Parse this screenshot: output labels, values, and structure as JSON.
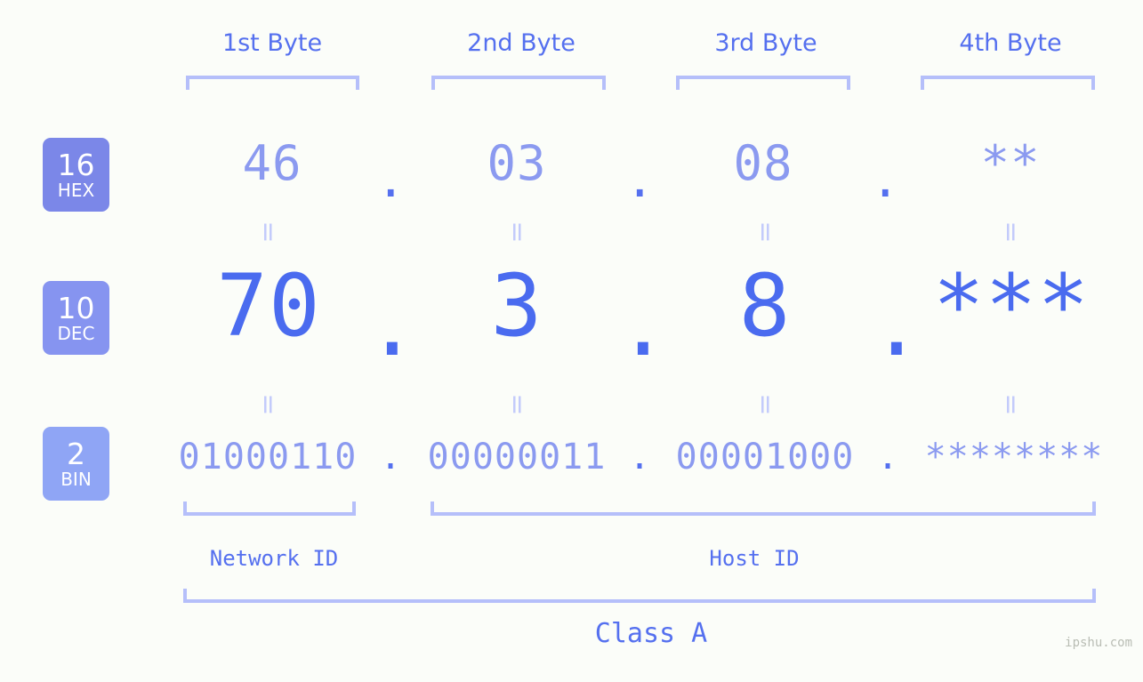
{
  "page": {
    "background_color": "#fbfdf9",
    "accent_color": "#5570ef",
    "accent_light": "#8b9af0",
    "accent_pale": "#b5bffa",
    "watermark": "ipshu.com"
  },
  "byte_headers": [
    {
      "label": "1st Byte"
    },
    {
      "label": "2nd Byte"
    },
    {
      "label": "3rd Byte"
    },
    {
      "label": "4th Byte"
    }
  ],
  "radix_rows": [
    {
      "num": "16",
      "tag": "HEX",
      "color": "#7b87e8"
    },
    {
      "num": "10",
      "tag": "DEC",
      "color": "#8694f0"
    },
    {
      "num": "2",
      "tag": "BIN",
      "color": "#8fa5f5"
    }
  ],
  "hex": {
    "values": [
      "46",
      "03",
      "08",
      "**"
    ],
    "separator": "."
  },
  "dec": {
    "values": [
      "70",
      "3",
      "8",
      "***"
    ],
    "separator": "."
  },
  "bin": {
    "values": [
      "01000110",
      "00000011",
      "00001000",
      "********"
    ],
    "separator": "."
  },
  "equals_mark": "=",
  "id_labels": [
    {
      "label": "Network ID"
    },
    {
      "label": "Host ID"
    }
  ],
  "class_label": "Class A"
}
